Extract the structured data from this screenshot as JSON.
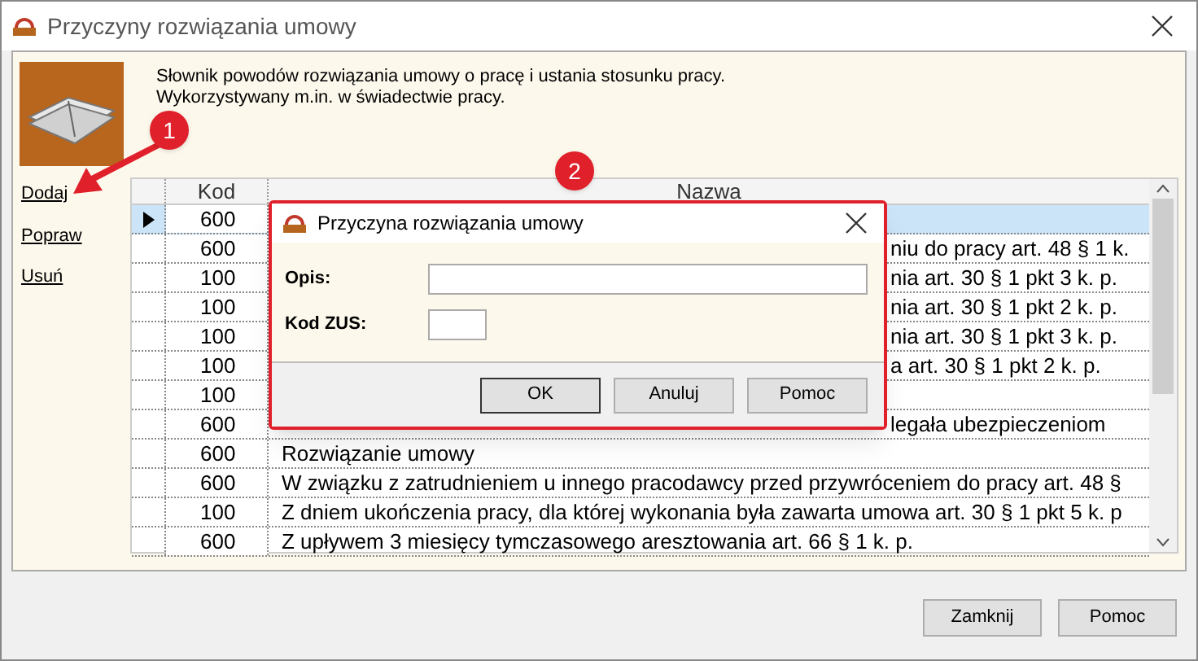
{
  "window": {
    "title": "Przyczyny rozwiązania umowy"
  },
  "description": {
    "line_1": "Słownik powodów rozwiązania umowy o pracę i ustania stosunku pracy.",
    "line_2": "Wykorzystywany m.in. w świadectwie pracy."
  },
  "side_links": [
    {
      "label": "Dodaj"
    },
    {
      "label": "Popraw"
    },
    {
      "label": "Usuń"
    }
  ],
  "table": {
    "columns": [
      "Kod",
      "Nazwa"
    ],
    "rows": [
      {
        "kind": "covered",
        "selected": true,
        "code": "600"
      },
      {
        "kind": "covered",
        "selected": false,
        "code": "600",
        "name": "niu do pracy art. 48 § 1 k."
      },
      {
        "kind": "covered",
        "selected": false,
        "code": "100",
        "name": "nia art. 30 § 1 pkt 3 k. p."
      },
      {
        "kind": "covered",
        "selected": false,
        "code": "100",
        "name": "nia art. 30 § 1 pkt 2 k. p."
      },
      {
        "kind": "covered",
        "selected": false,
        "code": "100",
        "name": "nia art. 30 § 1 pkt 3 k. p."
      },
      {
        "kind": "covered",
        "selected": false,
        "code": "100",
        "name": "a art. 30 § 1 pkt 2 k. p."
      },
      {
        "kind": "covered",
        "selected": false,
        "code": "100"
      },
      {
        "kind": "covered",
        "selected": false,
        "code": "600",
        "name": "legała ubezpieczeniom"
      },
      {
        "kind": "full",
        "selected": false,
        "code": "600",
        "name": "Rozwiązanie umowy"
      },
      {
        "kind": "full",
        "selected": false,
        "code": "600",
        "name": "W związku z zatrudnieniem u innego pracodawcy przed przywróceniem do pracy art. 48 §"
      },
      {
        "kind": "full",
        "selected": false,
        "code": "100",
        "name": "Z dniem ukończenia pracy, dla której wykonania była zawarta umowa art. 30 § 1 pkt 5 k. p"
      },
      {
        "kind": "full",
        "selected": false,
        "code": "600",
        "name": "Z upływem 3 miesięcy tymczasowego aresztowania art. 66 § 1 k. p."
      }
    ]
  },
  "dialog": {
    "title": "Przyczyna rozwiązania umowy",
    "fields": [
      {
        "label": "Opis:",
        "kind": "wide"
      },
      {
        "label": "Kod ZUS:",
        "kind": "short"
      }
    ],
    "buttons": [
      "OK",
      "Anuluj",
      "Pomoc"
    ]
  },
  "annotations": [
    "1",
    "2"
  ],
  "footer_buttons": [
    "Zamknij",
    "Pomoc"
  ]
}
